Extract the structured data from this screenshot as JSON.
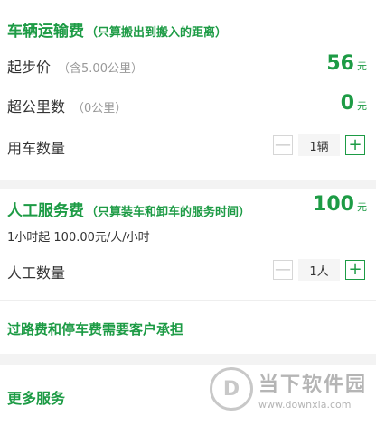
{
  "transport": {
    "title": "车辆运输费",
    "note": "（只算搬出到搬入的距离）",
    "start_price_label": "起步价",
    "start_price_sub": "（含5.00公里）",
    "start_price_value": "56",
    "start_price_unit": "元",
    "extra_km_label": "超公里数",
    "extra_km_sub": "（0公里）",
    "extra_km_value": "0",
    "extra_km_unit": "元",
    "vehicle_qty_label": "用车数量",
    "vehicle_qty_value": "1辆"
  },
  "labor": {
    "title": "人工服务费",
    "note": "（只算装车和卸车的服务时间）",
    "price_value": "100",
    "price_unit": "元",
    "desc": "1小时起 100.00元/人/小时",
    "qty_label": "人工数量",
    "qty_value": "1人"
  },
  "notice": {
    "text": "过路费和停车费需要客户承担"
  },
  "more": {
    "title": "更多服务"
  },
  "stepper": {
    "minus": "—",
    "plus": "+"
  },
  "watermark": {
    "logo": "D",
    "brand": "当下软件园",
    "url": "www.downxia.com"
  }
}
